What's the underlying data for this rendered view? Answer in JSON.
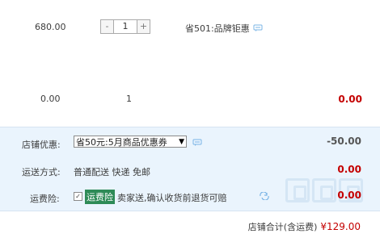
{
  "item_row_1": {
    "price": "680.00",
    "qty_minus": "-",
    "qty_value": "1",
    "qty_plus": "+",
    "promo_text": "省501:品牌钜惠"
  },
  "item_row_2": {
    "price": "0.00",
    "qty": "1",
    "subtotal": "0.00"
  },
  "shop_discount": {
    "label": "店铺优惠:",
    "selected": "省50元:5月商品优惠券",
    "amount": "-50.00"
  },
  "shipping": {
    "label": "运送方式:",
    "text": "普通配送 快递 免邮",
    "amount": "0.00"
  },
  "insurance": {
    "label": "运费险:",
    "badge": "运费险",
    "text": "卖家送,确认收货前退货可赔",
    "amount": "0.00"
  },
  "total": {
    "label": "店铺合计(含运费)",
    "value": "¥129.00"
  },
  "colors": {
    "accent_red": "#c40000",
    "panel_bg": "#eaf4fd",
    "badge_green": "#2e8b57"
  },
  "icons": {
    "chat": "chat-bubble-icon",
    "refresh": "refresh-icon"
  }
}
